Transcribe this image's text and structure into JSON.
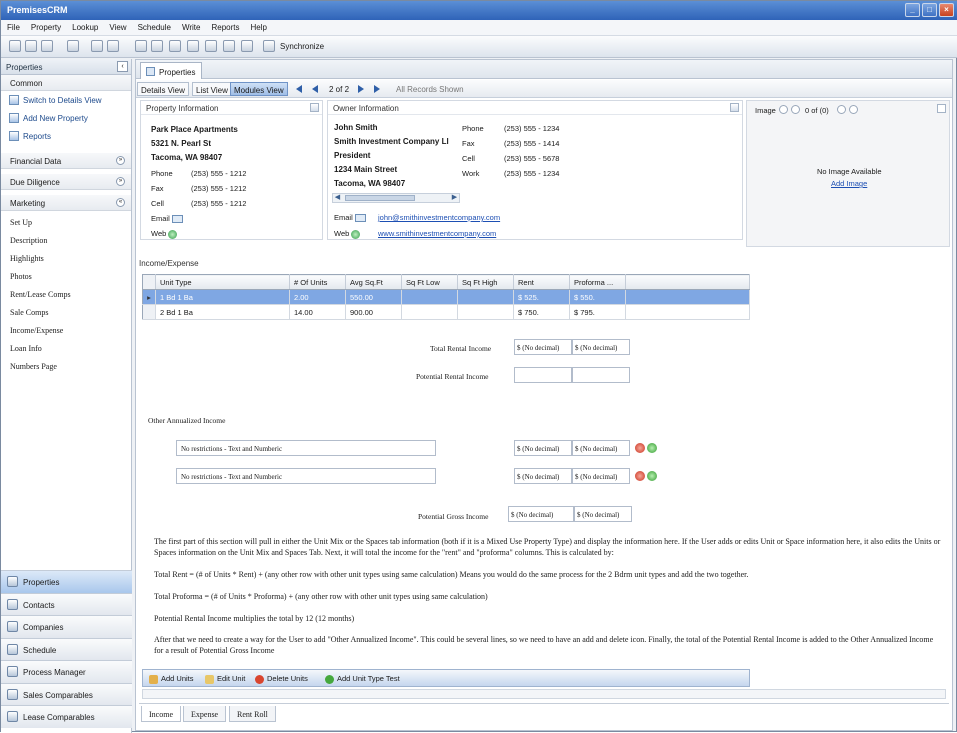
{
  "app": {
    "title": "PremisesCRM"
  },
  "menu": [
    "File",
    "Property",
    "Lookup",
    "View",
    "Schedule",
    "Write",
    "Reports",
    "Help"
  ],
  "toolbar": {
    "synchronize": "Synchronize"
  },
  "left": {
    "header": "Properties",
    "common_label": "Common",
    "tasks": [
      "Switch to Details View",
      "Add New Property",
      "Reports"
    ],
    "groups": [
      "Financial Data",
      "Due Diligence",
      "Marketing"
    ],
    "marketing_links": [
      "Set Up",
      "Description",
      "Highlights",
      "Photos",
      "Rent/Lease Comps",
      "Sale Comps",
      "Income/Expense",
      "Loan Info",
      "Numbers Page"
    ],
    "nav": [
      "Properties",
      "Contacts",
      "Companies",
      "Schedule",
      "Process Manager",
      "Sales Comparables",
      "Lease Comparables"
    ]
  },
  "main": {
    "tab": "Properties",
    "views": [
      "Details View",
      "List View",
      "Modules View"
    ],
    "record": "2 of 2",
    "all_records": "All Records Shown",
    "property": {
      "header": "Property Information",
      "name": "Park Place Apartments",
      "street": "5321 N. Pearl St",
      "city": "Tacoma, WA 98407",
      "phones": [
        {
          "k": "Phone",
          "v": "(253) 555 - 1212"
        },
        {
          "k": "Fax",
          "v": "(253) 555 - 1212"
        },
        {
          "k": "Cell",
          "v": "(253) 555 - 1212"
        }
      ],
      "email_label": "Email",
      "web_label": "Web"
    },
    "owner": {
      "header": "Owner Information",
      "lines": [
        "John Smith",
        "Smith Investment Company Ll",
        "President",
        "1234 Main Street",
        "Tacoma, WA 98407"
      ],
      "phones": [
        {
          "k": "Phone",
          "v": "(253) 555 - 1234"
        },
        {
          "k": "Fax",
          "v": "(253) 555 - 1414"
        },
        {
          "k": "Cell",
          "v": "(253) 555 - 5678"
        },
        {
          "k": "Work",
          "v": "(253) 555 - 1234"
        }
      ],
      "email_label": "Email",
      "email": "john@smithinvestmentcompany.com",
      "web_label": "Web",
      "web": "www.smithinvestmentcompany.com"
    },
    "image": {
      "label": "Image",
      "count": "0 of (0)",
      "none": "No Image Available",
      "add": "Add Image"
    },
    "income": {
      "header": "Income/Expense",
      "columns": [
        "Unit Type",
        "# Of Units",
        "Avg Sq.Ft",
        "Sq Ft Low",
        "Sq Ft High",
        "Rent",
        "Proforma ..."
      ],
      "rows": [
        [
          "1 Bd 1 Ba",
          "2.00",
          "550.00",
          "",
          "",
          "$ 525.",
          "$ 550."
        ],
        [
          "2 Bd 1 Ba",
          "14.00",
          "900.00",
          "",
          "",
          "$ 750.",
          "$ 795."
        ]
      ],
      "total_rental_label": "Total Rental Income",
      "total_rental_values": [
        "$ (No decimal)",
        "$ (No decimal)"
      ],
      "potential_rental_label": "Potential Rental Income",
      "other_label": "Other Annualized Income",
      "other_rows": [
        {
          "text": "No restrictions - Text and Numberic",
          "values": [
            "$ (No decimal)",
            "$ (No decimal)"
          ]
        },
        {
          "text": "No restrictions - Text and Numberic",
          "values": [
            "$ (No decimal)",
            "$ (No decimal)"
          ]
        }
      ],
      "gross_label": "Potential Gross Income",
      "gross_values": [
        "$ (No decimal)",
        "$ (No decimal)"
      ],
      "paragraphs": [
        "The first part of this section will pull in either the Unit Mix or the Spaces tab information (both if it is a Mixed Use Property Type) and display the information here. If the User adds or edits Unit or Space information here, it also edits the Units or Spaces information on the Unit Mix and Spaces Tab. Next, it will total the income for the \"rent\" and \"proforma\" columns. This is calculated by:",
        "Total Rent = (# of Units * Rent) + (any other row with other unit types using same calculation) Means you would do the same process for the 2 Bdrm unit types and add the two together.",
        "Total Proforma = (# of Units * Proforma) + (any other row with other unit types using same calculation)",
        "Potential Rental Income multiplies the total by 12 (12 months)",
        "After that we need to create a way for the User to add \"Other Annualized Income\". This could be several lines, so we need to have an add and delete icon. Finally, the total of the Potential Rental Income is added to the Other Annualized Income for a result of Potential Gross Income"
      ],
      "actions": [
        "Add Units",
        "Edit Unit",
        "Delete Units",
        "Add Unit Type Test"
      ]
    },
    "bottom_tabs": [
      "Income",
      "Expense",
      "Rent Roll"
    ]
  }
}
